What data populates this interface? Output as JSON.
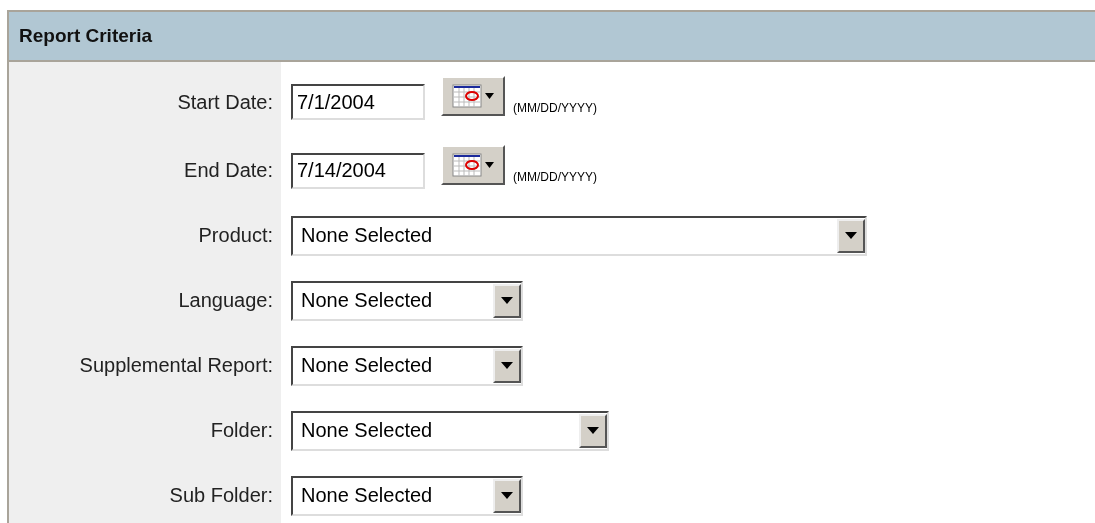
{
  "panel": {
    "title": "Report Criteria"
  },
  "fields": [
    {
      "kind": "date",
      "label": "Start Date:",
      "value": "7/1/2004",
      "hint": "(MM/DD/YYYY)"
    },
    {
      "kind": "date",
      "label": "End Date:",
      "value": "7/14/2004",
      "hint": "(MM/DD/YYYY)"
    },
    {
      "kind": "select",
      "label": "Product:",
      "value": "None Selected"
    },
    {
      "kind": "select",
      "label": "Language:",
      "value": "None Selected"
    },
    {
      "kind": "select",
      "label": "Supplemental Report:",
      "value": "None Selected"
    },
    {
      "kind": "select",
      "label": "Folder:",
      "value": "None Selected"
    },
    {
      "kind": "select",
      "label": "Sub Folder:",
      "value": "None Selected"
    }
  ]
}
